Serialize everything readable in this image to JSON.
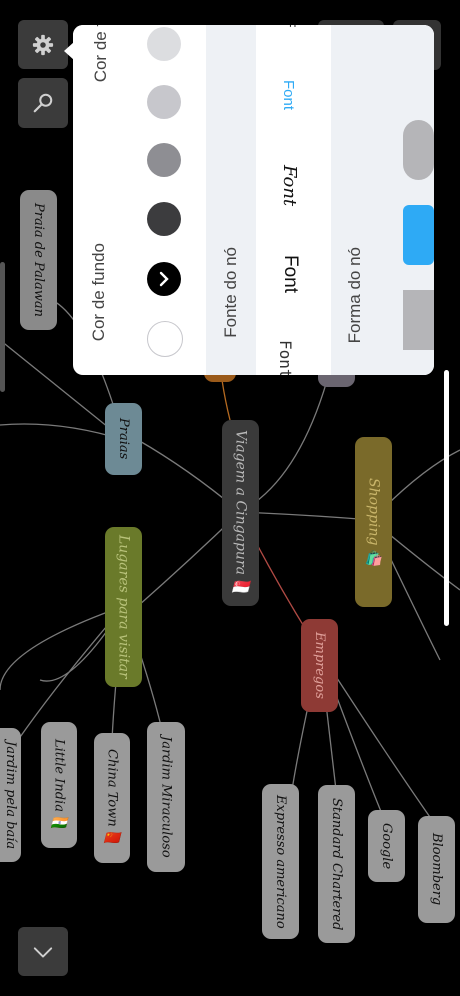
{
  "mindmap": {
    "central": "Viagem a Cingapura 🇸🇬",
    "praias": "Praias",
    "praia_palawan": "Praia de Palawan",
    "lugares": "Lugares para visitar",
    "jardim_baia": "Jardim pela baía",
    "little_india": "Little India 🇮🇳",
    "china_town": "China Town 🇨🇳",
    "jardim_miraculoso": "Jardim Miraculoso",
    "empregos": "Empregos",
    "expresso": "Expresso americano",
    "standard": "Standard Chartered",
    "google": "Google",
    "bloomberg": "Bloomberg",
    "shopping": "Shopping 🛍️"
  },
  "panel": {
    "cor_label": "Cor de fundo",
    "fonte_label": "Fonte do nó",
    "forma_label": "Forma do nó",
    "font_options": [
      "Font",
      "Font",
      "Font",
      "Font",
      "F"
    ],
    "swatch_colors": [
      "#ffffff",
      "#000000",
      "#3c3c3e",
      "#8e8e93",
      "#c7c7cc",
      "#dcdde0"
    ],
    "accent": "#2eaaf5"
  }
}
